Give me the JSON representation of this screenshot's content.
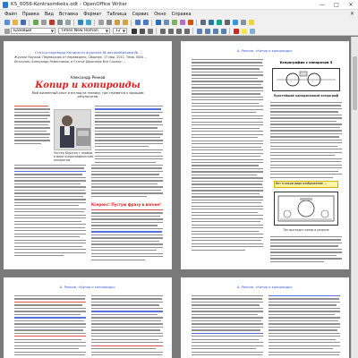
{
  "window": {
    "title": "KS_0056-Kontrasmkeks.odt - OpenOffice Writer",
    "min": "—",
    "max": "□",
    "close": "✕"
  },
  "menu": [
    "Файл",
    "Правка",
    "Вид",
    "Вставка",
    "Формат",
    "Таблица",
    "Сервис",
    "Окно",
    "Справка"
  ],
  "menu_close": "✕",
  "format_bar": {
    "style": "Базовый",
    "font": "Times New Roman",
    "size": "12"
  },
  "page1": {
    "header": "Статья перевода Копира из журнала № автомобилями № ...",
    "meta1": "Журнал Кружки, Переводчик от переведено, Сборник, 17 мар. 2011, Тема, ISSN ...",
    "meta2": "Источник: Александр Ременников, в Статье Двоичные Все Ссылки: ...",
    "author": "Александр Ренков",
    "title": "Копир и копироиды",
    "subtitle": "Мой жизненный опыт и взгляд на технику, где стремятся к хорошим результатам",
    "photo_caption": "Честер Карлсон с первым в мире ксерографическим аппаратом",
    "red_heading": "Ксерокс! Пустую фразу в вагоне!"
  },
  "page2": {
    "header": "А. Ренков, «Копир и копироиды»",
    "figure_title": "Ксерография с аппаратом 5",
    "figure_label": "Простейший однодисковый ксерограф",
    "hl_text": "Вот в каком виде изображение ...",
    "figure2_caption": "Так выглядит копир в разрезе"
  },
  "page3": {
    "header": "А. Ренков, «Копир и копироиды»"
  },
  "page4": {
    "header": "А. Ренков, «Копир и копироиды»"
  }
}
